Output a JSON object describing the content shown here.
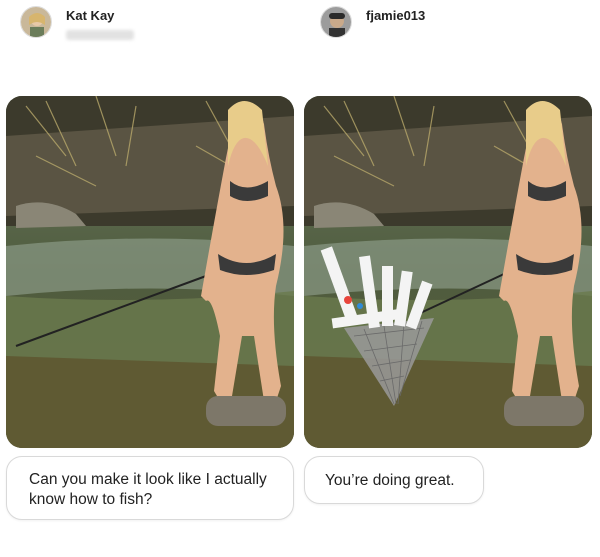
{
  "left_post": {
    "username": "Kat Kay",
    "avatar": "avatar-photo",
    "photo": "woman-in-bikini-holding-fishing-rod-in-river",
    "request_text": "Can you make it look like I actually know how to fish?"
  },
  "right_post": {
    "username": "fjamie013",
    "avatar": "avatar-photo",
    "photo": "edited-woman-holding-net-full-of-compliment-notes",
    "reply_text": "You’re doing great."
  },
  "colors": {
    "bubble_border": "#d9d9d9",
    "text": "#222222",
    "background": "#ffffff"
  }
}
